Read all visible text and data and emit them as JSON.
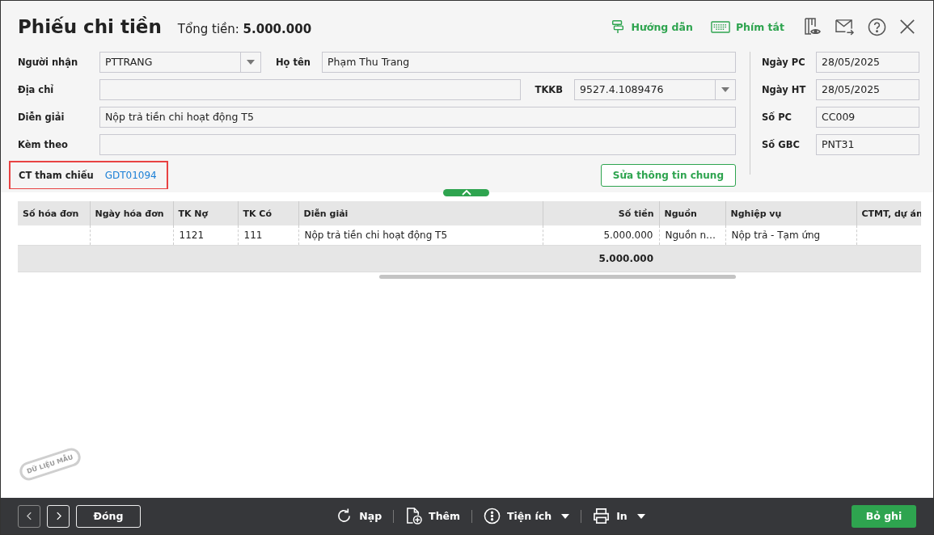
{
  "window": {
    "title": "Phiếu chi tiền",
    "total_label": "Tổng tiền:",
    "total_value": "5.000.000"
  },
  "header_actions": [
    {
      "label": "Hướng dẫn",
      "kind": "guide"
    },
    {
      "label": "Phím tắt",
      "kind": "keyboard"
    }
  ],
  "header_icons": [
    {
      "kind": "view"
    },
    {
      "kind": "mail"
    },
    {
      "kind": "help"
    },
    {
      "kind": "close"
    }
  ],
  "form": {
    "rows": [
      [
        {
          "label": "Người nhận",
          "value": "PTTRANG",
          "kind": "combo"
        },
        {
          "label": "Họ tên",
          "value": "Phạm Thu Trang",
          "kind": "text"
        }
      ],
      [
        {
          "label": "Địa chỉ",
          "kind": "text"
        },
        {
          "label": "TKKB",
          "value": "9527.4.1089476",
          "kind": "combo"
        }
      ],
      [
        {
          "label": "Diễn giải",
          "value": "Nộp trả tiền chi hoạt động T5",
          "kind": "text"
        }
      ],
      [
        {
          "label": "Kèm theo",
          "kind": "text"
        }
      ]
    ],
    "reference": {
      "label": "CT tham chiếu",
      "value": "GDT01094",
      "highlighted": true
    },
    "edit_button": "Sửa thông tin chung"
  },
  "side_fields": [
    {
      "label": "Ngày PC",
      "value": "28/05/2025"
    },
    {
      "label": "Ngày HT",
      "value": "28/05/2025"
    },
    {
      "label": "Số PC",
      "value": "CC009"
    },
    {
      "label": "Số GBC",
      "value": "PNT31"
    }
  ],
  "table": {
    "columns": [
      {
        "label": "Số hóa đơn",
        "kind": "text"
      },
      {
        "label": "Ngày hóa đơn",
        "kind": "text"
      },
      {
        "label": "TK Nợ",
        "kind": "text"
      },
      {
        "label": "TK Có",
        "kind": "text"
      },
      {
        "label": "Diễn giải",
        "kind": "text"
      },
      {
        "label": "Số tiền",
        "kind": "amount"
      },
      {
        "label": "Nguồn",
        "kind": "text"
      },
      {
        "label": "Nghiệp vụ",
        "kind": "text"
      },
      {
        "label": "CTMT, dự án",
        "kind": "text"
      }
    ],
    "rows": [
      [
        null,
        null,
        "1121",
        "111",
        "Nộp trả tiền chi hoạt động T5",
        "5.000.000",
        "Nguồn n…",
        "Nộp trả - Tạm ứng",
        null
      ]
    ],
    "total": "5.000.000"
  },
  "stamp": {
    "text": "DỮ LIỆU MẪU"
  },
  "footer": {
    "close_button": "Đóng",
    "actions": [
      {
        "label": "Nạp",
        "kind": "refresh",
        "dropdown": false
      },
      {
        "label": "Thêm",
        "kind": "add",
        "dropdown": false
      },
      {
        "label": "Tiện ích",
        "kind": "more",
        "dropdown": true
      },
      {
        "label": "In",
        "kind": "print",
        "dropdown": true
      }
    ],
    "save_button": "Bỏ ghi"
  }
}
